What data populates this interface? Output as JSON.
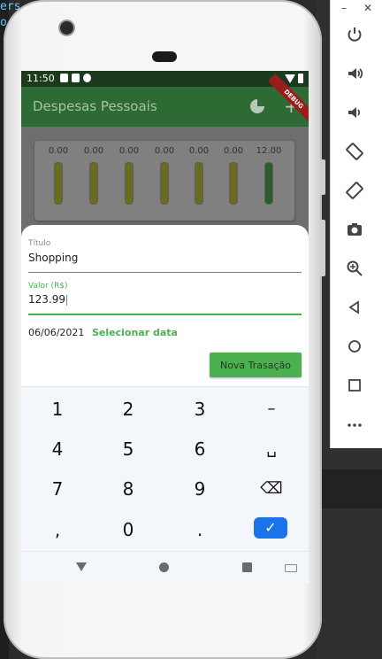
{
  "background": {
    "editor_text_1": "ers",
    "editor_text_2": "o"
  },
  "status_bar": {
    "time": "11:50"
  },
  "app_bar": {
    "title": "Despesas Pessoais",
    "debug_banner": "DEBUG",
    "add_symbol": "+"
  },
  "chart_data": {
    "type": "bar",
    "values": [
      0.0,
      0.0,
      0.0,
      0.0,
      0.0,
      0.0,
      12.0
    ],
    "value_labels": [
      "0.00",
      "0.00",
      "0.00",
      "0.00",
      "0.00",
      "0.00",
      "12.00"
    ],
    "fill_fractions": [
      0,
      0,
      0,
      0,
      0,
      0,
      1
    ]
  },
  "form": {
    "title_label": "Título",
    "title_value": "Shopping",
    "value_label": "Valor (R$)",
    "value_value": "123.99",
    "date_text": "06/06/2021",
    "select_date_label": "Selecionar data",
    "submit_label": "Nova Trasação"
  },
  "keyboard": {
    "row1": [
      "1",
      "2",
      "3",
      "–"
    ],
    "row2": [
      "4",
      "5",
      "6",
      "␣"
    ],
    "row3": [
      "7",
      "8",
      "9",
      "⌫"
    ],
    "row4": [
      ",",
      "0",
      "."
    ],
    "enter": "✓"
  },
  "emulator": {
    "minimize": "–",
    "close": "✕",
    "icons": [
      "power-icon",
      "volume-up-icon",
      "volume-down-icon",
      "rotate-left-icon",
      "rotate-right-icon",
      "camera-icon",
      "zoom-icon",
      "back-icon",
      "home-icon",
      "overview-icon",
      "more-icon"
    ]
  }
}
